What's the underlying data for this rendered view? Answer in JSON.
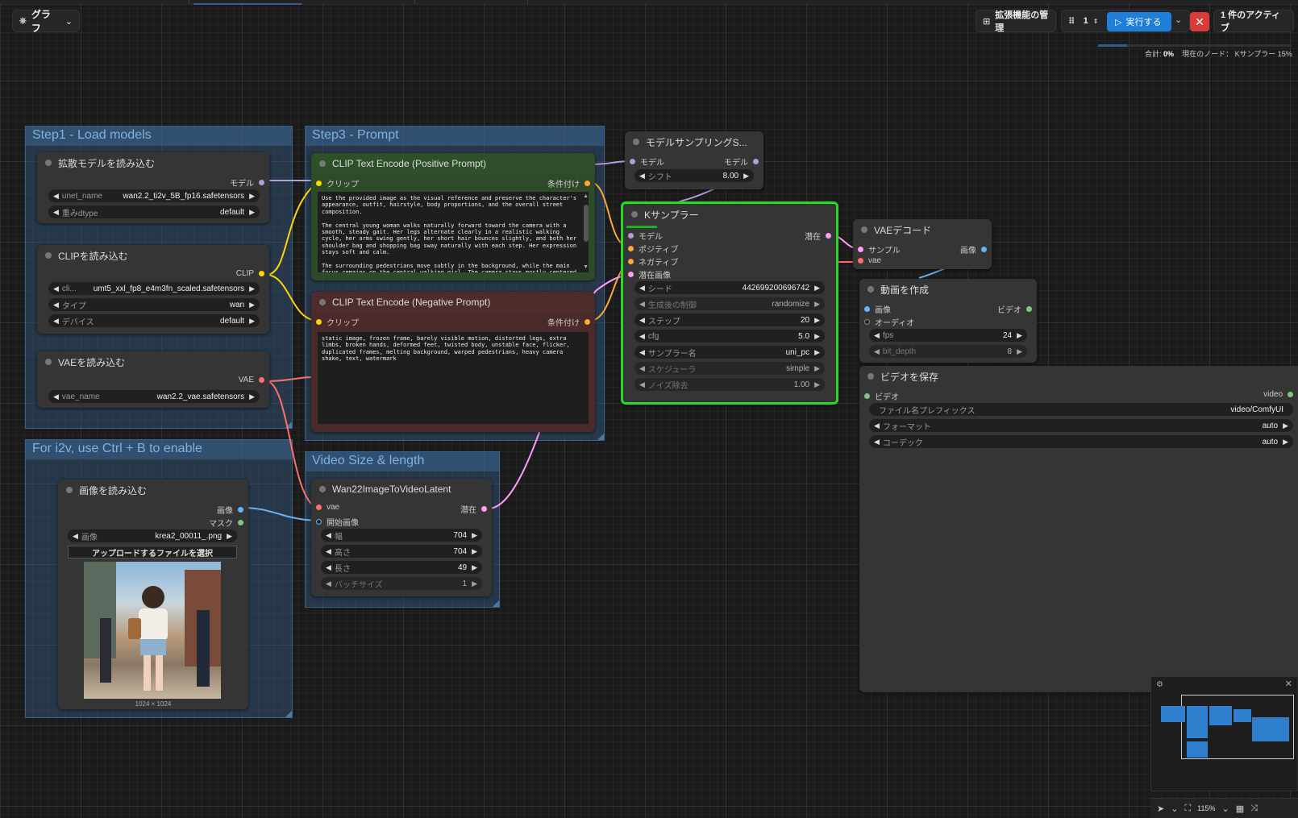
{
  "toolbar": {
    "graph_menu_label": "グラフ",
    "extensions_button": "拡張機能の管理",
    "queue_count": "1",
    "run_button": "実行する",
    "active_label": "1 件のアクティブ",
    "status_total_label": "合計:",
    "status_total_value": "0%",
    "status_current": "現在のノード： Kサンプラー 15%",
    "progress_fraction": 0.15
  },
  "groups": {
    "load_models": "Step1 - Load models",
    "i2v": "For i2v, use Ctrl + B to enable",
    "prompt": "Step3 - Prompt",
    "video_size": "Video Size & length"
  },
  "nodes": {
    "diffusion": {
      "title": "拡散モデルを読み込む",
      "out_model": "モデル",
      "unet_label": "unet_name",
      "unet_value": "wan2.2_ti2v_5B_fp16.safetensors",
      "dtype_label": "重みdtype",
      "dtype_value": "default"
    },
    "clip_loader": {
      "title": "CLIPを読み込む",
      "out_clip": "CLIP",
      "name_label": "cli...",
      "name_value": "umt5_xxl_fp8_e4m3fn_scaled.safetensors",
      "type_label": "タイプ",
      "type_value": "wan",
      "device_label": "デバイス",
      "device_value": "default"
    },
    "vae_loader": {
      "title": "VAEを読み込む",
      "out_vae": "VAE",
      "name_label": "vae_name",
      "name_value": "wan2.2_vae.safetensors"
    },
    "load_image": {
      "title": "画像を読み込む",
      "out_image": "画像",
      "out_mask": "マスク",
      "image_label": "画像",
      "image_value": "krea2_00011_.png",
      "upload_button": "アップロードするファイルを選択",
      "image_size": "1024 × 1024"
    },
    "pos_prompt": {
      "title": "CLIP Text Encode (Positive Prompt)",
      "in_clip": "クリップ",
      "out_cond": "条件付け",
      "text": "Use the provided image as the visual reference and preserve the character's appearance, outfit, hairstyle, body proportions, and the overall street composition.\n\nThe central young woman walks naturally forward toward the camera with a smooth, steady gait. Her legs alternate clearly in a realistic walking cycle, her arms swing gently, her short hair bounces slightly, and both her shoulder bag and shopping bag sway naturally with each step. Her expression stays soft and calm.\n\nThe surrounding pedestrians move subtly in the background, while the main focus remains on the central walking girl. The camera stays mostly centered"
    },
    "neg_prompt": {
      "title": "CLIP Text Encode (Negative Prompt)",
      "in_clip": "クリップ",
      "out_cond": "条件付け",
      "text": "static image, frozen frame, barely visible motion, distorted legs, extra limbs, broken hands, deformed feet, twisted body, unstable face, flicker, duplicated frames, melting background, warped pedestrians, heavy camera shake, text, watermark"
    },
    "wan_latent": {
      "title": "Wan22ImageToVideoLatent",
      "in_vae": "vae",
      "in_start": "開始画像",
      "out_latent": "潜在",
      "width_label": "幅",
      "width_value": "704",
      "height_label": "高さ",
      "height_value": "704",
      "length_label": "長さ",
      "length_value": "49",
      "batch_label": "バッチサイズ",
      "batch_value": "1"
    },
    "model_sampling": {
      "title": "モデルサンプリングS...",
      "in_model": "モデル",
      "out_model": "モデル",
      "shift_label": "シフト",
      "shift_value": "8.00"
    },
    "ksampler": {
      "title": "Kサンプラー",
      "progress_fraction": 0.15,
      "in_model": "モデル",
      "in_positive": "ポジティブ",
      "in_negative": "ネガティブ",
      "in_latent": "潜在画像",
      "out_latent": "潜在",
      "seed_label": "シード",
      "seed_value": "442699200696742",
      "control_label": "生成後の制御",
      "control_value": "randomize",
      "steps_label": "ステップ",
      "steps_value": "20",
      "cfg_label": "cfg",
      "cfg_value": "5.0",
      "sampler_label": "サンプラー名",
      "sampler_value": "uni_pc",
      "scheduler_label": "スケジューラ",
      "scheduler_value": "simple",
      "denoise_label": "ノイズ除去",
      "denoise_value": "1.00"
    },
    "vae_decode": {
      "title": "VAEデコード",
      "in_samples": "サンプル",
      "in_vae": "vae",
      "out_image": "画像"
    },
    "create_video": {
      "title": "動画を作成",
      "in_image": "画像",
      "in_audio": "オーディオ",
      "out_video": "ビデオ",
      "fps_label": "fps",
      "fps_value": "24",
      "bitdepth_label": "bit_depth",
      "bitdepth_value": "8"
    },
    "save_video": {
      "title": "ビデオを保存",
      "in_video": "ビデオ",
      "out_video": "video",
      "prefix_label": "ファイル名プレフィックス",
      "prefix_value": "video/ComfyUI",
      "format_label": "フォーマット",
      "format_value": "auto",
      "codec_label": "コーデック",
      "codec_value": "auto"
    }
  },
  "bottom": {
    "zoom": "115%"
  },
  "colors": {
    "model_link": "#b39ddb",
    "clip_link": "#ffd500",
    "cond_link": "#ffa931",
    "vae_link": "#ff6e6e",
    "latent_link": "#ff9cf9",
    "image_link": "#64b5f6",
    "mask_link": "#81c784",
    "ksampler_border": "#22dd22",
    "run_button": "#1f7fd8"
  }
}
